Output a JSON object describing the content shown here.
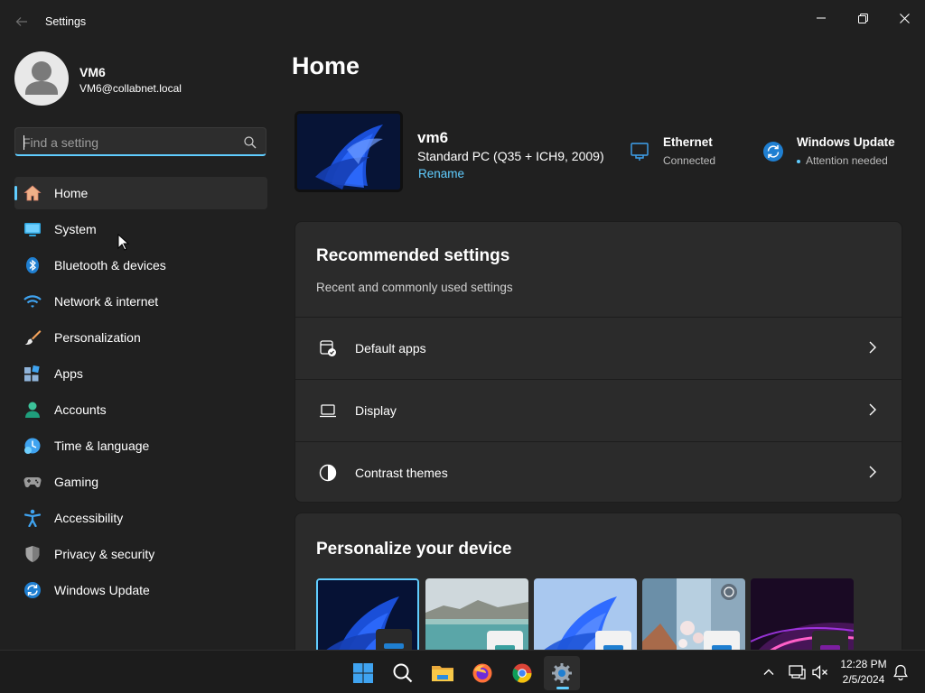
{
  "window": {
    "title": "Settings",
    "back_icon": "back-arrow-icon",
    "controls": [
      "minimize",
      "maximize",
      "close"
    ]
  },
  "profile": {
    "name": "VM6",
    "email": "VM6@collabnet.local"
  },
  "search": {
    "placeholder": "Find a setting",
    "value": ""
  },
  "sidebar": {
    "items": [
      {
        "label": "Home",
        "icon": "home-icon",
        "selected": true
      },
      {
        "label": "System",
        "icon": "system-icon"
      },
      {
        "label": "Bluetooth & devices",
        "icon": "bluetooth-icon"
      },
      {
        "label": "Network & internet",
        "icon": "wifi-icon"
      },
      {
        "label": "Personalization",
        "icon": "brush-icon"
      },
      {
        "label": "Apps",
        "icon": "apps-icon"
      },
      {
        "label": "Accounts",
        "icon": "accounts-icon"
      },
      {
        "label": "Time & language",
        "icon": "time-language-icon"
      },
      {
        "label": "Gaming",
        "icon": "gamepad-icon"
      },
      {
        "label": "Accessibility",
        "icon": "accessibility-icon"
      },
      {
        "label": "Privacy & security",
        "icon": "shield-icon"
      },
      {
        "label": "Windows Update",
        "icon": "windows-update-icon"
      }
    ]
  },
  "main": {
    "title": "Home",
    "device": {
      "name": "vm6",
      "model": "Standard PC (Q35 + ICH9, 2009)",
      "rename_label": "Rename"
    },
    "status": {
      "ethernet": {
        "title": "Ethernet",
        "subtitle": "Connected"
      },
      "windows_update": {
        "title": "Windows Update",
        "subtitle": "Attention needed"
      }
    },
    "recommended": {
      "title": "Recommended settings",
      "subtitle": "Recent and commonly used settings",
      "rows": [
        {
          "label": "Default apps",
          "icon": "default-apps-icon"
        },
        {
          "label": "Display",
          "icon": "laptop-icon"
        },
        {
          "label": "Contrast themes",
          "icon": "contrast-icon"
        }
      ]
    },
    "personalize": {
      "title": "Personalize your device",
      "themes": [
        "windows-dark-bloom",
        "lake-landscape",
        "windows-light-bloom",
        "flowers-collage",
        "glow-purple"
      ]
    }
  },
  "taskbar": {
    "apps": [
      "start-icon",
      "search-icon",
      "file-explorer-icon",
      "firefox-icon",
      "chrome-icon",
      "settings-icon"
    ],
    "active_app": "settings-icon",
    "time": "12:28 PM",
    "date": "2/5/2024"
  },
  "colors": {
    "accent": "#60cdff",
    "background": "#202020",
    "card": "#2b2b2b",
    "taskbar": "#1c1c1c"
  }
}
